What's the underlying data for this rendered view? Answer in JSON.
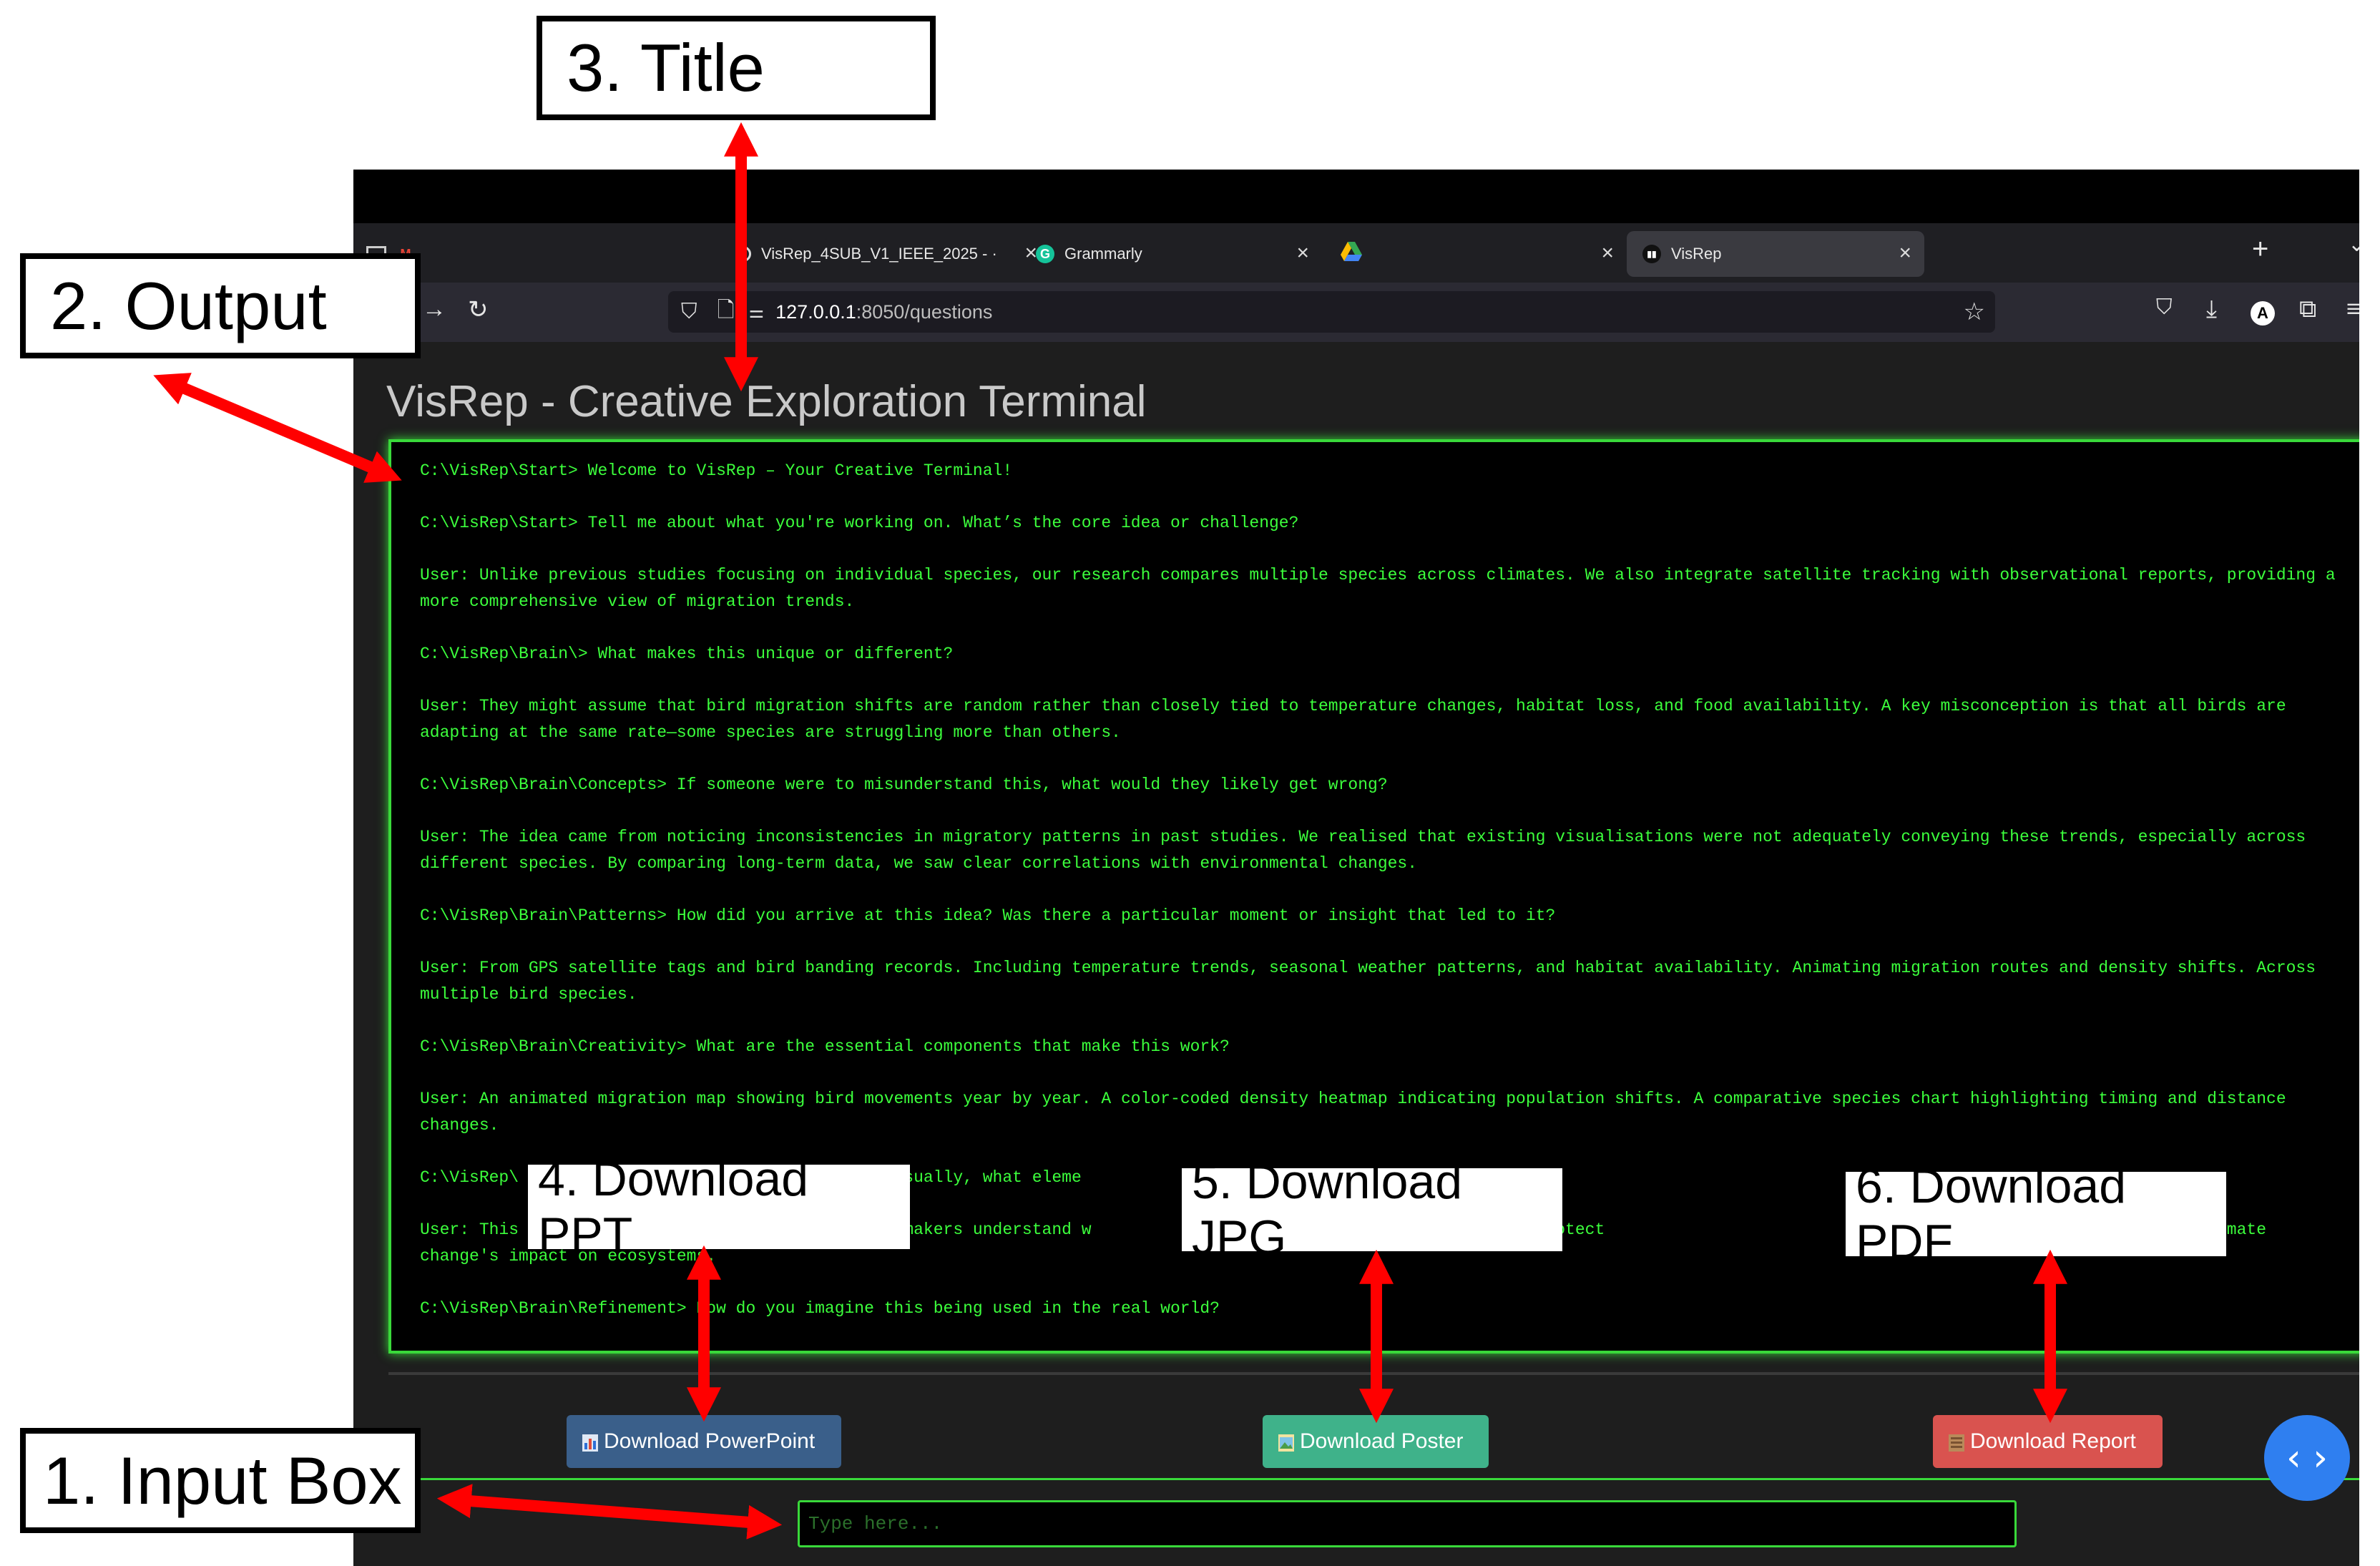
{
  "browser": {
    "tabs": [
      {
        "label": "",
        "icon": "gmail-icon"
      },
      {
        "label": "VisRep_4SUB_V1_IEEE_2025 - ·",
        "icon": "overleaf-icon"
      },
      {
        "label": "Grammarly",
        "icon": "grammarly-icon"
      },
      {
        "label": "",
        "icon": "drive-icon"
      },
      {
        "label": "VisRep",
        "icon": "visrep-icon",
        "active": true
      }
    ],
    "url_host": "127.0.0.1",
    "url_path": ":8050/questions",
    "new_tab": "+"
  },
  "app": {
    "title": "VisRep - Creative Exploration Terminal",
    "terminal_lines": [
      "C:\\VisRep\\Start> Welcome to VisRep – Your Creative Terminal!",
      "C:\\VisRep\\Start> Tell me about what you're working on. What’s the core idea or challenge?",
      "User: Unlike previous studies focusing on individual species, our research compares multiple species across climates. We also integrate satellite tracking with observational reports, providing a more comprehensive view of migration trends.",
      "C:\\VisRep\\Brain\\> What makes this unique or different?",
      "User: They might assume that bird migration shifts are random rather than closely tied to temperature changes, habitat loss, and food availability. A key misconception is that all birds are adapting at the same rate—some species are struggling more than others.",
      "C:\\VisRep\\Brain\\Concepts> If someone were to misunderstand this, what would they likely get wrong?",
      "User: The idea came from noticing inconsistencies in migratory patterns in past studies. We realised that existing visualisations were not adequately conveying these trends, especially across different species. By comparing long-term data, we saw clear correlations with environmental changes.",
      "C:\\VisRep\\Brain\\Patterns> How did you arrive at this idea? Was there a particular moment or insight that led to it?",
      "User: From GPS satellite tags and bird banding records. Including temperature trends, seasonal weather patterns, and habitat availability. Animating migration routes and density shifts. Across multiple bird species.",
      "C:\\VisRep\\Brain\\Creativity> What are the essential components that make this work?",
      "User: An animated migration map showing bird movements year by year. A color-coded density heatmap indicating population shifts. A comparative species chart highlighting timing and distance changes.",
      "C:\\VisRep\\                                this visually, what eleme",
      "User: This                                 policymakers understand w                          ch regions require protect                           l outreach to raise awareness of climate change's impact on ecosystems.",
      "C:\\VisRep\\Brain\\Refinement> How do you imagine this being used in the real world?"
    ],
    "buttons": {
      "ppt": "Download PowerPoint",
      "jpg": "Download Poster",
      "pdf": "Download Report"
    },
    "input_placeholder": "Type here..."
  },
  "annotations": {
    "input_box": "1. Input Box",
    "output": "2. Output",
    "title": "3. Title",
    "download_ppt": "4. Download PPT",
    "download_jpg": "5. Download JPG",
    "download_pdf": "6. Download PDF"
  },
  "colors": {
    "terminal_text": "#3cff3c",
    "terminal_border": "#39d93a",
    "arrow": "#ff0000",
    "ppt_button": "#3a5f8a",
    "jpg_button": "#3fb28a",
    "pdf_button": "#d9534f"
  }
}
